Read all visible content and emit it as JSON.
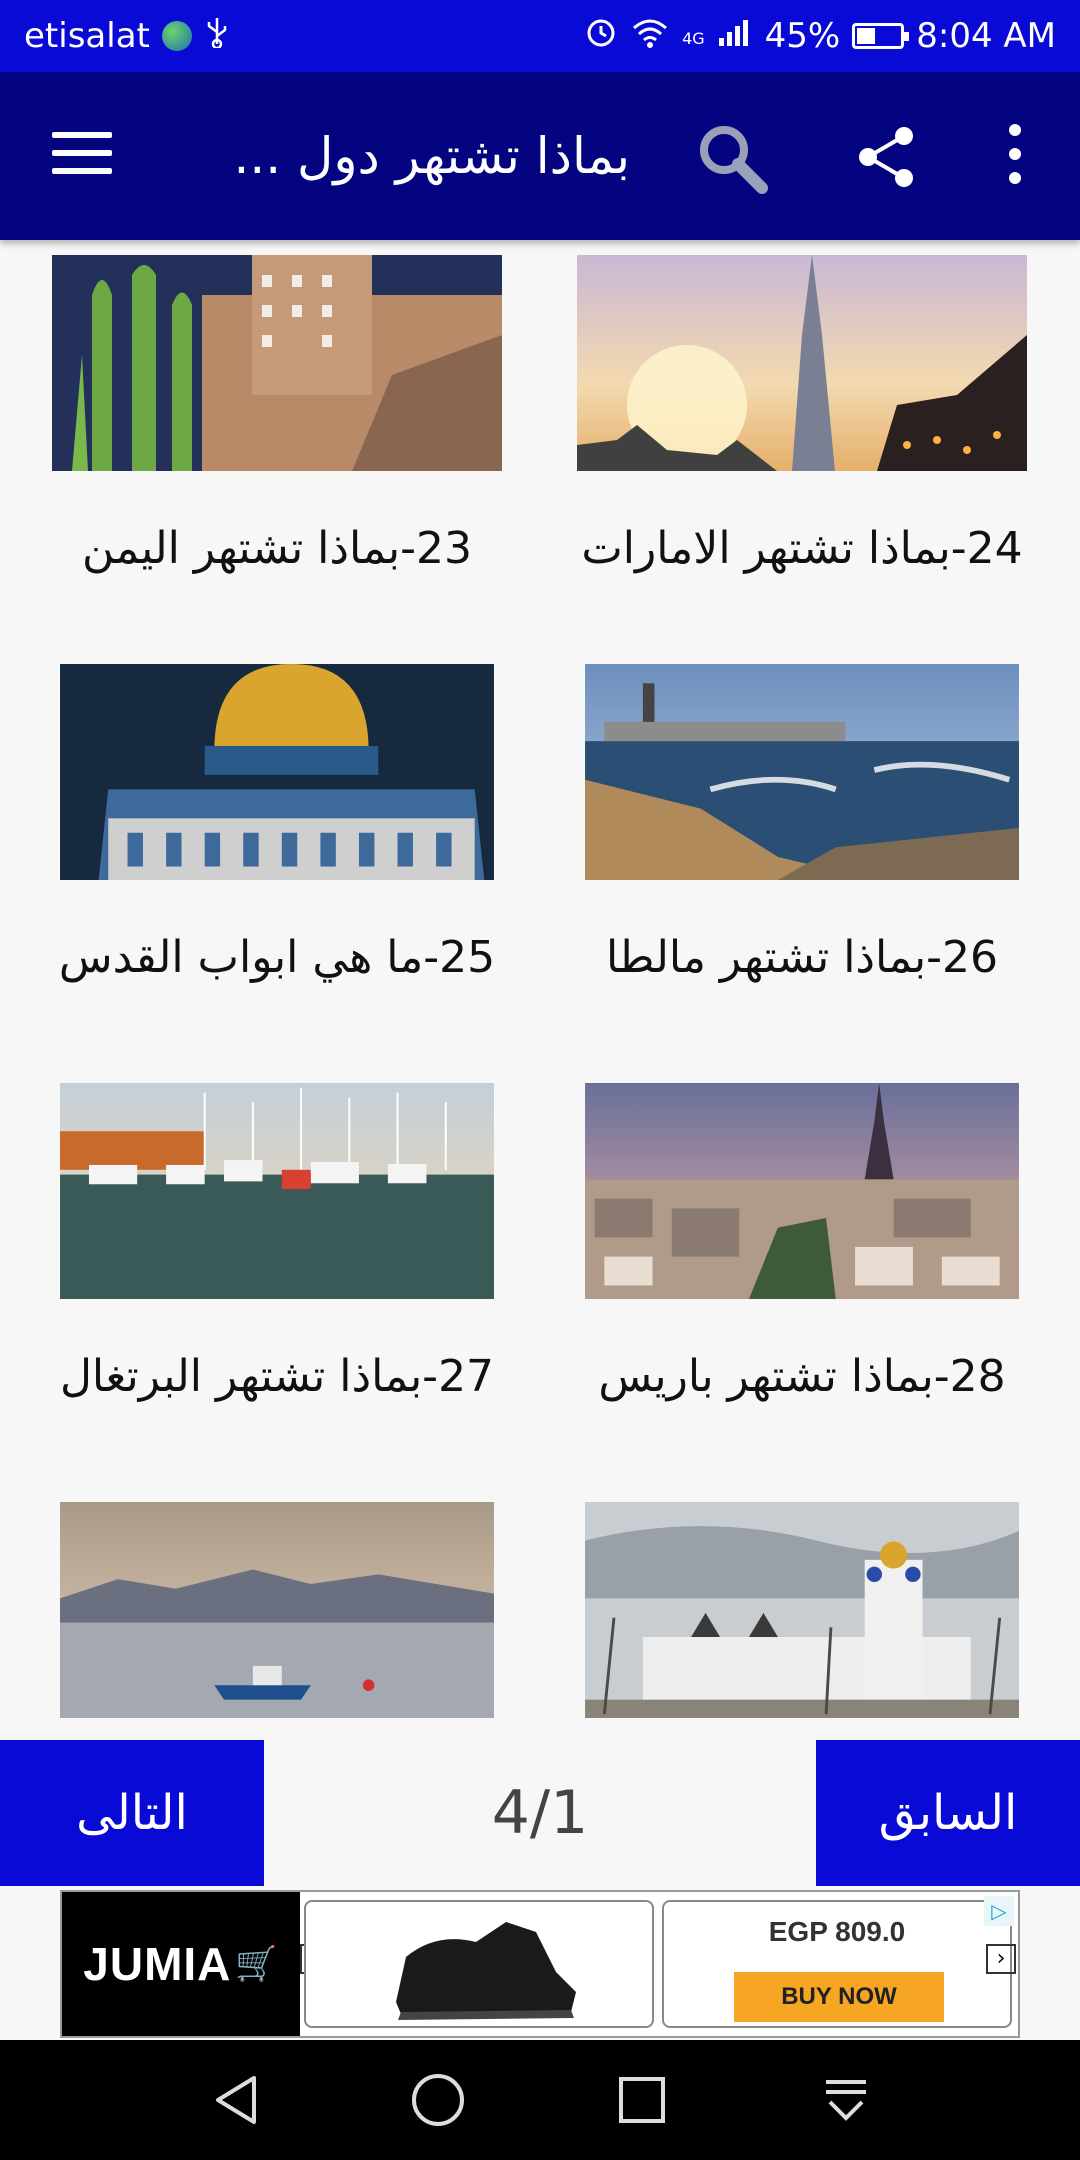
{
  "status_bar": {
    "carrier": "etisalat",
    "network": "4G",
    "battery_percent": "45%",
    "battery_level": 0.45,
    "time": "8:04 AM",
    "icons": [
      "globe-icon",
      "usb-icon",
      "alarm-icon",
      "wifi-icon",
      "signal-icon",
      "battery-icon"
    ]
  },
  "app_bar": {
    "title": "بماذا تشتهر دول ...",
    "icons": [
      "menu-icon",
      "search-icon",
      "share-icon",
      "more-vert-icon"
    ],
    "color": "#040480"
  },
  "items": [
    {
      "label": "23-بماذا تشتهر اليمن",
      "image": "yemen"
    },
    {
      "label": "24-بماذا تشتهر الامارات",
      "image": "uae"
    },
    {
      "label": "25-ما هي ابواب القدس",
      "image": "jerusalem"
    },
    {
      "label": "26-بماذا تشتهر مالطا",
      "image": "malta"
    },
    {
      "label": "27-بماذا تشتهر البرتغال",
      "image": "portugal"
    },
    {
      "label": "28-بماذا تشتهر باريس",
      "image": "paris"
    },
    {
      "label": "",
      "image": "harbor"
    },
    {
      "label": "",
      "image": "palace"
    }
  ],
  "pager": {
    "next_label": "التالى",
    "prev_label": "السابق",
    "page_indicator": "4/1",
    "accent": "#0a0ad6"
  },
  "ad": {
    "brand": "JUMIA",
    "price": "EGP 809.0",
    "cta": "BUY NOW"
  }
}
